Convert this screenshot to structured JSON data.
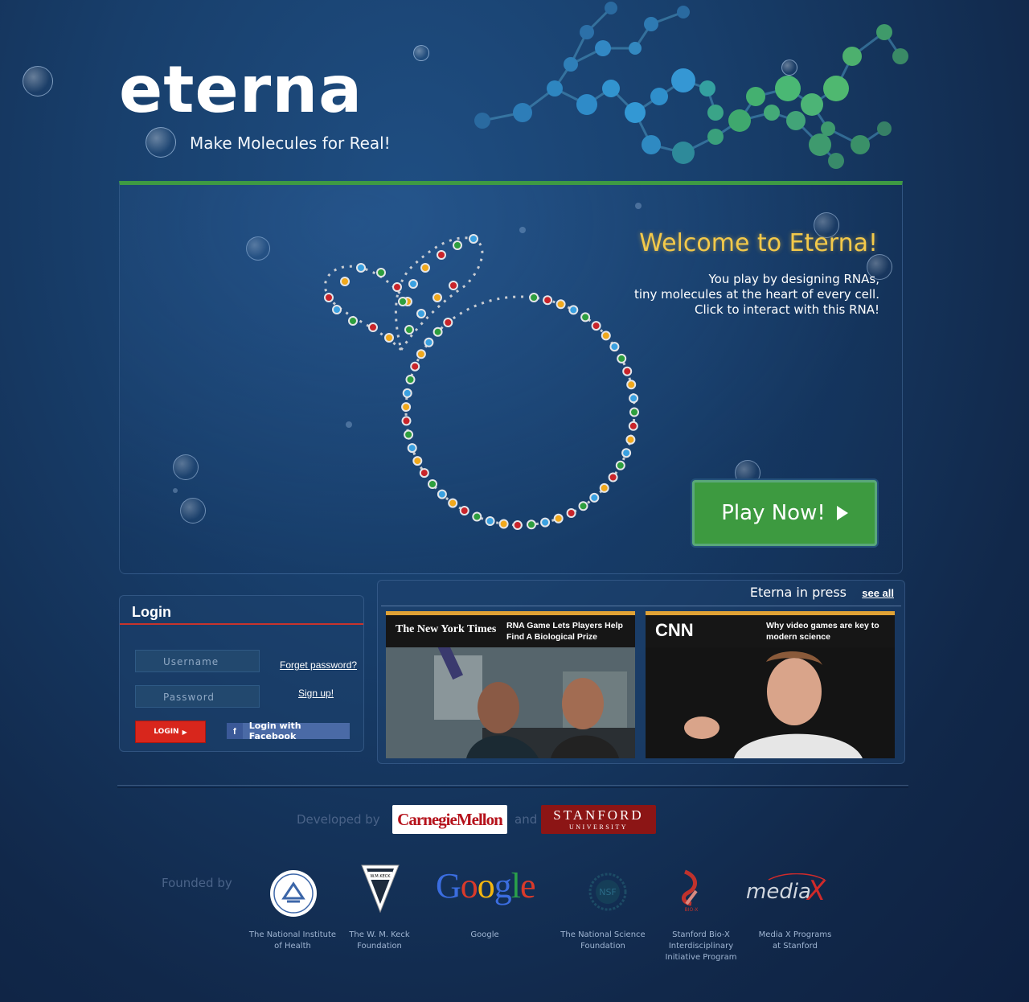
{
  "header": {
    "logo_text": "eterna",
    "tagline": "Make Molecules for Real!"
  },
  "hero": {
    "welcome": "Welcome to Eterna!",
    "description_lines": [
      "You play by designing RNAs,",
      "tiny molecules at the heart of every cell.",
      "Click to interact with this RNA!"
    ],
    "play_button": "Play Now!"
  },
  "login": {
    "title": "Login",
    "username_placeholder": "Username",
    "password_placeholder": "Password",
    "forgot_password": "Forget password?",
    "sign_up": "Sign up!",
    "login_button": "LOGIN",
    "facebook_button": "Login with Facebook"
  },
  "press": {
    "title": "Eterna in press",
    "see_all": "see all",
    "items": [
      {
        "source": "The New York Times",
        "headline_line1": "RNA Game Lets Players Help",
        "headline_line2": "Find A Biological Prize"
      },
      {
        "source": "CNN",
        "headline_line1": "Why video games are key to",
        "headline_line2": "modern science"
      }
    ]
  },
  "footer": {
    "developed_by": "Developed by",
    "and": "and",
    "cmu": "CarnegieMellon",
    "stanford_line1": "STANFORD",
    "stanford_line2": "UNIVERSITY",
    "founded_by": "Founded by",
    "sponsors": [
      {
        "name_line1": "The National Institute",
        "name_line2": "of Health",
        "name_line3": "",
        "logo_text": "NIH"
      },
      {
        "name_line1": "The W. M. Keck",
        "name_line2": "Foundation",
        "name_line3": "",
        "logo_text": "W.M.KECK FOUNDATION"
      },
      {
        "name_line1": "Google",
        "name_line2": "",
        "name_line3": "",
        "logo_text": "Google"
      },
      {
        "name_line1": "The National Science",
        "name_line2": "Foundation",
        "name_line3": "",
        "logo_text": "NSF"
      },
      {
        "name_line1": "Stanford Bio-X",
        "name_line2": "Interdisciplinary",
        "name_line3": "Initiative Program",
        "logo_text": "BIO-X"
      },
      {
        "name_line1": "Media X Programs",
        "name_line2": "at Stanford",
        "name_line3": "",
        "logo_text": "mediaX"
      }
    ]
  },
  "colors": {
    "accent_green": "#3d9a40",
    "welcome_gold": "#f3c94a",
    "login_red": "#d8261c",
    "facebook_blue": "#4a6aa6"
  }
}
